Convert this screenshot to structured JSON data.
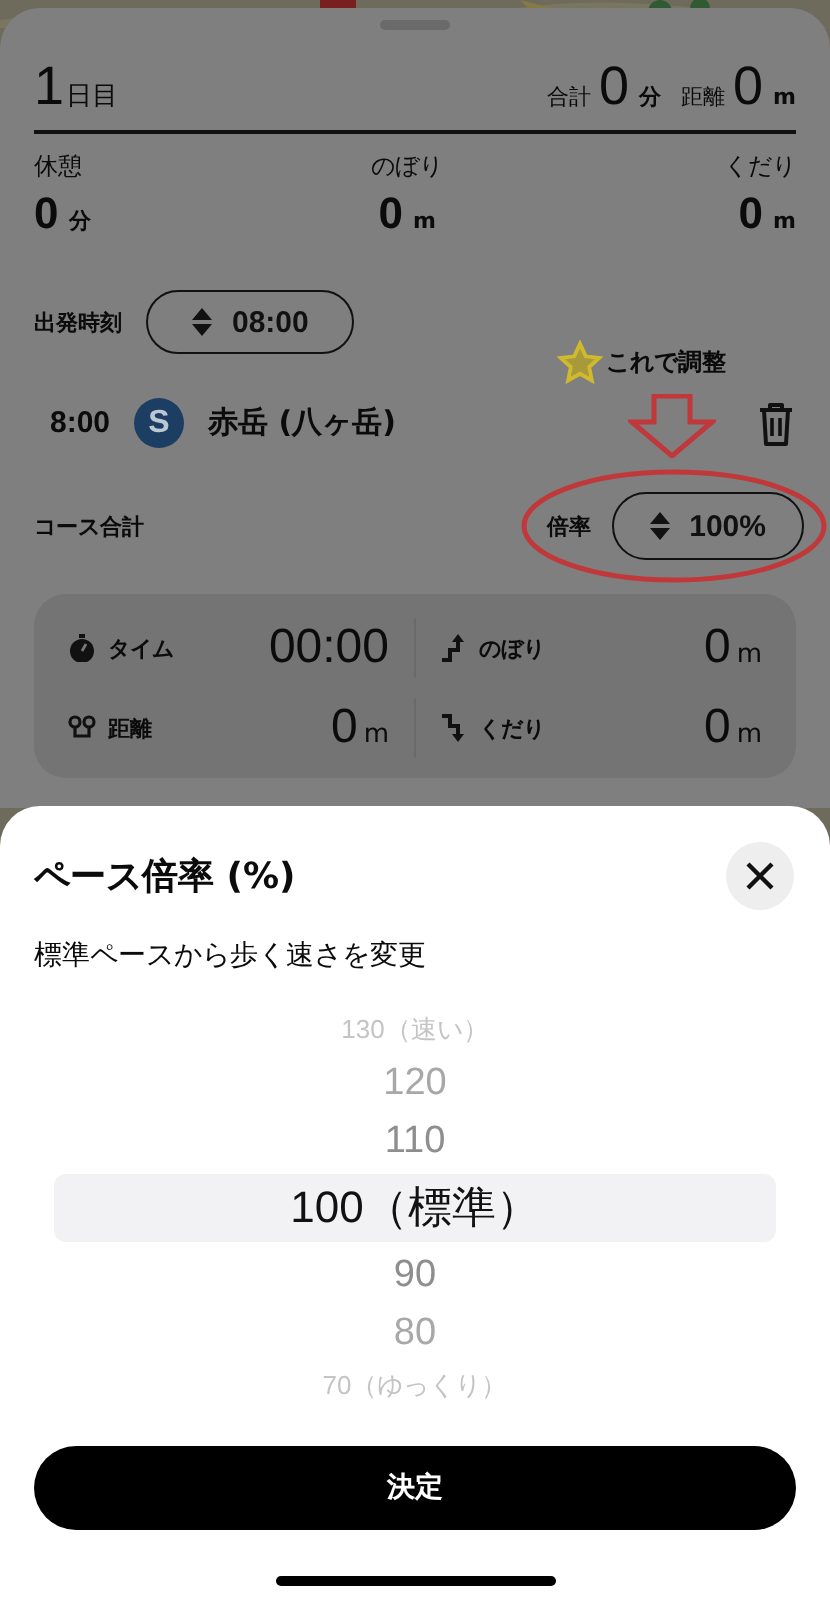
{
  "day": {
    "number": "1",
    "unit": "日目",
    "total_label": "合計",
    "total_value": "0",
    "total_unit": "分",
    "distance_label": "距離",
    "distance_value": "0",
    "distance_unit": "m"
  },
  "stats": [
    {
      "label": "休憩",
      "value": "0",
      "unit": "分"
    },
    {
      "label": "のぼり",
      "value": "0",
      "unit": "m"
    },
    {
      "label": "くだり",
      "value": "0",
      "unit": "m"
    }
  ],
  "departure": {
    "label": "出発時刻",
    "value": "08:00"
  },
  "waypoints": [
    {
      "time": "8:00",
      "badge": "S",
      "name": "赤岳 (八ヶ岳)"
    }
  ],
  "annotation": {
    "text": "これで調整"
  },
  "course": {
    "label": "コース合計",
    "rate_label": "倍率",
    "rate_value": "100%"
  },
  "summary": [
    {
      "kind": "time",
      "label": "タイム",
      "value": "00:00"
    },
    {
      "kind": "ascent",
      "label": "のぼり",
      "value": "0",
      "unit": "m"
    },
    {
      "kind": "distance",
      "label": "距離",
      "value": "0",
      "unit": "m"
    },
    {
      "kind": "descent",
      "label": "くだり",
      "value": "0",
      "unit": "m"
    }
  ],
  "sheet": {
    "title": "ペース倍率 (%)",
    "subtitle": "標準ペースから歩く速さを変更",
    "confirm": "決定",
    "options": [
      {
        "label": "130（速い）",
        "selected": false
      },
      {
        "label": "120",
        "selected": false
      },
      {
        "label": "110",
        "selected": false
      },
      {
        "label": "100（標準）",
        "selected": true
      },
      {
        "label": "90",
        "selected": false
      },
      {
        "label": "80",
        "selected": false
      },
      {
        "label": "70（ゆっくり）",
        "selected": false
      }
    ]
  }
}
